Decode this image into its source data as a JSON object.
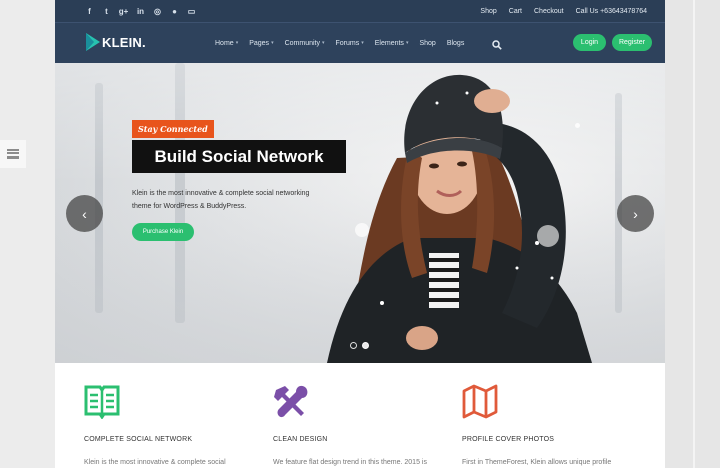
{
  "topbar": {
    "social_icons": [
      "facebook-icon",
      "twitter-icon",
      "google-plus-icon",
      "linkedin-icon",
      "dribbble-icon",
      "github-icon",
      "twitch-icon"
    ],
    "social_glyphs": [
      "f",
      "t",
      "g+",
      "in",
      "◎",
      "●",
      "▭"
    ],
    "links": [
      "Shop",
      "Cart",
      "Checkout",
      "Call Us +63643478764"
    ]
  },
  "nav": {
    "logo_text": "KLEIN.",
    "menu": [
      {
        "label": "Home",
        "dropdown": true
      },
      {
        "label": "Pages",
        "dropdown": true
      },
      {
        "label": "Community",
        "dropdown": true
      },
      {
        "label": "Forums",
        "dropdown": true
      },
      {
        "label": "Elements",
        "dropdown": true
      },
      {
        "label": "Shop",
        "dropdown": false
      },
      {
        "label": "Blogs",
        "dropdown": false
      }
    ],
    "login_label": "Login",
    "register_label": "Register"
  },
  "hero": {
    "badge": "Stay Connected",
    "headline": "Build Social Network",
    "description": "Klein is the most innovative & complete social networking theme for WordPress & BuddyPress.",
    "button_label": "Purchase Klein",
    "prev_glyph": "‹",
    "next_glyph": "›",
    "slides": 2,
    "active_slide": 2
  },
  "features": [
    {
      "icon": "book-icon",
      "title": "COMPLETE SOCIAL NETWORK",
      "text": "Klein is the most innovative & complete social"
    },
    {
      "icon": "tools-icon",
      "title": "CLEAN DESIGN",
      "text": "We feature flat design trend in this theme. 2015 is"
    },
    {
      "icon": "map-icon",
      "title": "PROFILE COVER PHOTOS",
      "text": "First in ThemeForest, Klein allows unique profile"
    }
  ],
  "colors": {
    "header_bg": "#2e425c",
    "topbar_bg": "#2b3e56",
    "accent_green": "#2bbf70",
    "badge_orange": "#e8541c",
    "book_icon": "#2bbf70",
    "tools_icon": "#7b4fa8",
    "map_icon": "#e05a3a"
  }
}
